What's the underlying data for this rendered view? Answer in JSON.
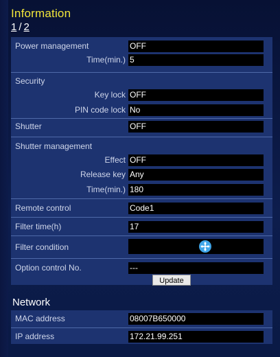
{
  "header": {
    "title": "Information",
    "page_current": "1",
    "page_separator": "/",
    "page_next": "2"
  },
  "rows": {
    "power_management": {
      "label": "Power management",
      "value": "OFF"
    },
    "time_min": {
      "label": "Time(min.)",
      "value": "5"
    },
    "security": {
      "label": "Security"
    },
    "key_lock": {
      "label": "Key lock",
      "value": "OFF"
    },
    "pin_code_lock": {
      "label": "PIN code lock",
      "value": "No"
    },
    "shutter": {
      "label": "Shutter",
      "value": "OFF"
    },
    "shutter_management": {
      "label": "Shutter management"
    },
    "effect": {
      "label": "Effect",
      "value": "OFF"
    },
    "release_key": {
      "label": "Release key",
      "value": "Any"
    },
    "time_min_2": {
      "label": "Time(min.)",
      "value": "180"
    },
    "remote_control": {
      "label": "Remote control",
      "value": "Code1"
    },
    "filter_time": {
      "label": "Filter time(h)",
      "value": "17"
    },
    "filter_condition": {
      "label": "Filter condition",
      "icon": "fan-icon"
    },
    "option_control": {
      "label": "Option control No.",
      "value": "---"
    }
  },
  "update_button": "Update",
  "network": {
    "title": "Network",
    "mac_address": {
      "label": "MAC address",
      "value": "08007B650000"
    },
    "ip_address": {
      "label": "IP address",
      "value": "172.21.99.251"
    }
  },
  "colors": {
    "title": "#f2e63a",
    "panel": "#1d3370",
    "value_bg": "#000000",
    "icon": "#3fa5e8"
  }
}
